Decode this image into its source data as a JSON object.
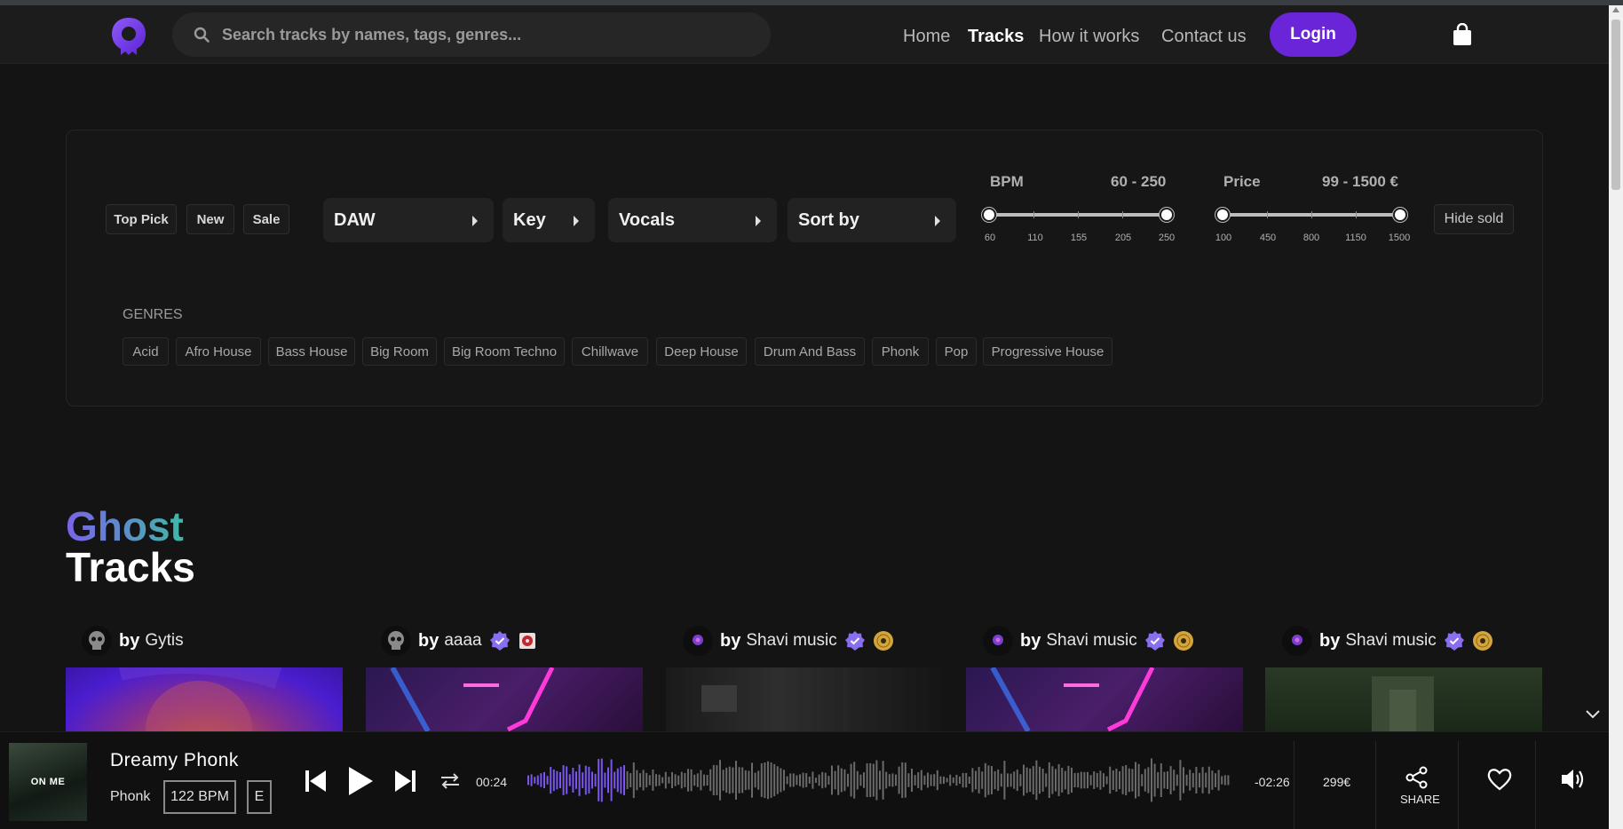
{
  "header": {
    "search_placeholder": "Search tracks by names, tags, genres...",
    "nav": [
      "Home",
      "Tracks",
      "How it works",
      "Contact us"
    ],
    "login_label": "Login"
  },
  "filters": {
    "chips": [
      "Top Pick",
      "New",
      "Sale"
    ],
    "dropdowns": [
      "DAW",
      "Key",
      "Vocals",
      "Sort by"
    ],
    "bpm": {
      "label": "BPM",
      "range_text": "60 - 250",
      "min": 60,
      "max": 250,
      "ticks": [
        "60",
        "110",
        "155",
        "205",
        "250"
      ]
    },
    "price": {
      "label": "Price",
      "range_text": "99 - 1500 €",
      "min": 99,
      "max": 1500,
      "ticks": [
        "100",
        "450",
        "800",
        "1150",
        "1500"
      ]
    },
    "hide_sold_label": "Hide sold",
    "genres_label": "GENRES",
    "genres": [
      "Acid",
      "Afro House",
      "Bass House",
      "Big Room",
      "Big Room Techno",
      "Chillwave",
      "Deep House",
      "Drum And Bass",
      "Phonk",
      "Pop",
      "Progressive House"
    ]
  },
  "section": {
    "title_line1": "Ghost",
    "title_line2": "Tracks"
  },
  "cards": [
    {
      "by": "by",
      "artist": "Gytis"
    },
    {
      "by": "by",
      "artist": "aaaa"
    },
    {
      "by": "by",
      "artist": "Shavi music"
    },
    {
      "by": "by",
      "artist": "Shavi music"
    },
    {
      "by": "by",
      "artist": "Shavi music"
    }
  ],
  "player": {
    "cover_text": "ON ME",
    "title": "Dreamy Phonk",
    "genre": "Phonk",
    "bpm": "122 BPM",
    "key": "E",
    "elapsed": "00:24",
    "remaining": "-02:26",
    "progress_fraction": 0.14,
    "price": "299€",
    "share_label": "SHARE"
  },
  "colors": {
    "accent": "#6a25d8",
    "verified": "#8a6ef0",
    "gold": "#d4a53a",
    "background": "#141414"
  }
}
